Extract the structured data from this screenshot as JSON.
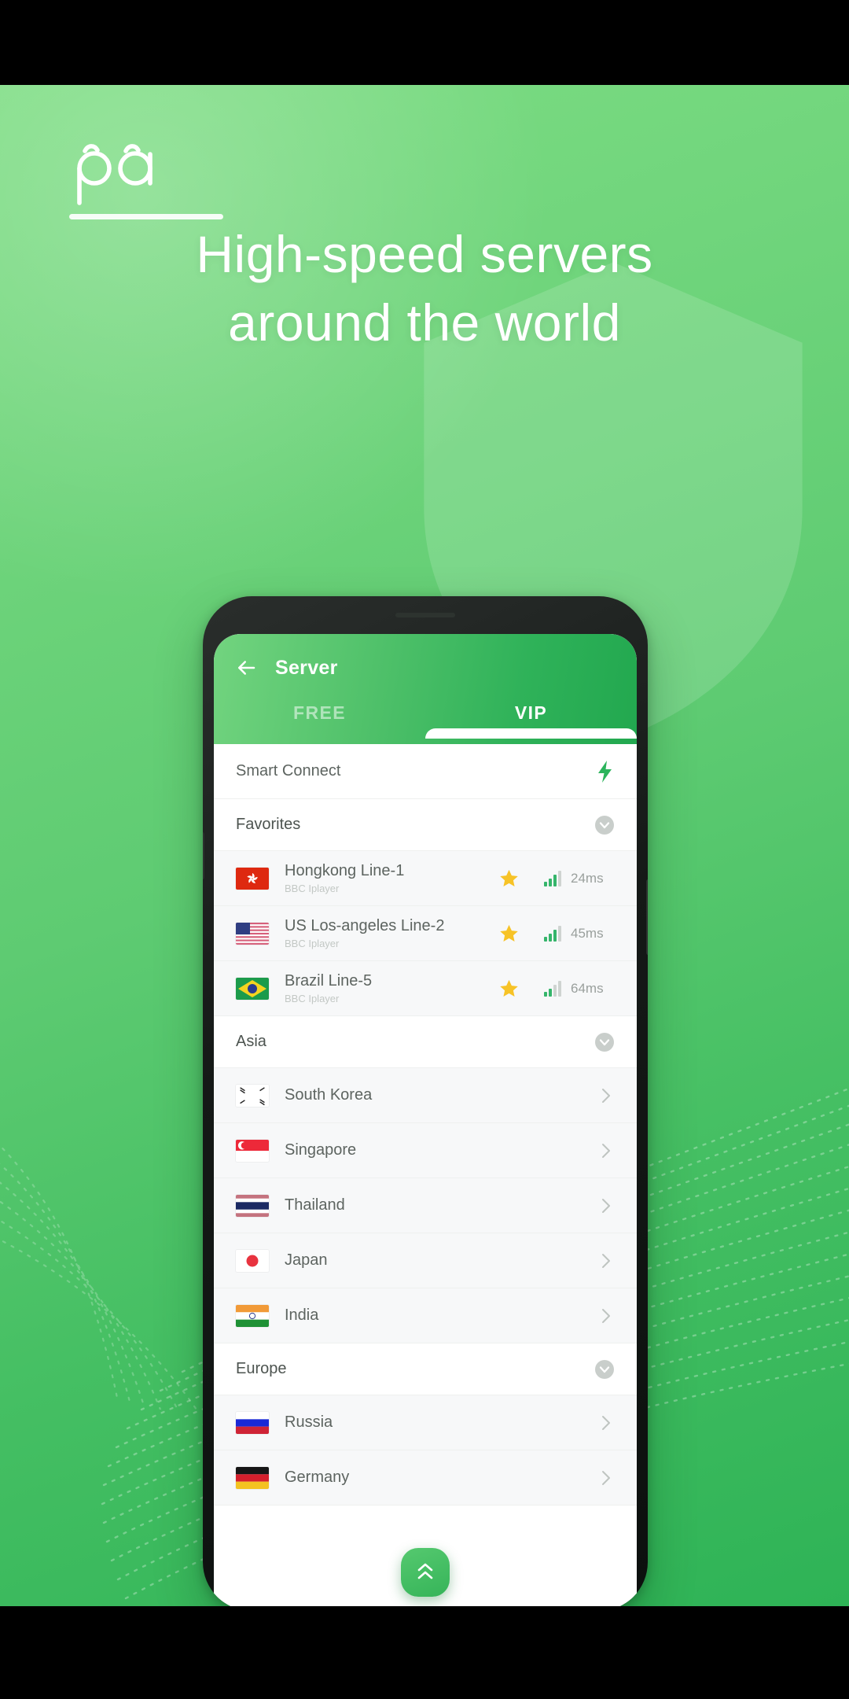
{
  "brand": {
    "wordmark": "pa",
    "logo_icon": "panda-wordmark-logo"
  },
  "headline": {
    "line1": "High-speed servers",
    "line2": "around the world"
  },
  "colors": {
    "accent_green": "#2fb259",
    "header_gradient_start": "#72d47f",
    "header_gradient_end": "#22a84f",
    "poster_bg_start": "#7ddd83",
    "poster_bg_end": "#2eb356",
    "star_gold": "#f7c327",
    "signal_green": "#35b56b",
    "muted_text": "#9aa09d",
    "row_text": "#5d6460",
    "letterbox": "#000000"
  },
  "app": {
    "header": {
      "back_icon": "arrow-left-icon",
      "title": "Server",
      "tabs": [
        {
          "label": "FREE",
          "active": false
        },
        {
          "label": "VIP",
          "active": true
        }
      ]
    },
    "smart_connect": {
      "label": "Smart Connect",
      "icon": "lightning-bolt-icon"
    },
    "sections": [
      {
        "title": "Favorites",
        "collapse_icon": "chevron-down-circle-icon",
        "type": "servers",
        "items": [
          {
            "name": "Hongkong Line-1",
            "subtitle": "BBC Iplayer",
            "flag": "hongkong-flag",
            "favorite_icon": "star-filled-icon",
            "signal_icon": "signal-bars-icon",
            "signal_level": 3,
            "ping": "24ms"
          },
          {
            "name": "US Los-angeles Line-2",
            "subtitle": "BBC Iplayer",
            "flag": "us-flag",
            "favorite_icon": "star-filled-icon",
            "signal_icon": "signal-bars-icon",
            "signal_level": 3,
            "ping": "45ms"
          },
          {
            "name": "Brazil Line-5",
            "subtitle": "BBC Iplayer",
            "flag": "brazil-flag",
            "favorite_icon": "star-filled-icon",
            "signal_icon": "signal-bars-icon",
            "signal_level": 2,
            "ping": "64ms"
          }
        ]
      },
      {
        "title": "Asia",
        "collapse_icon": "chevron-down-circle-icon",
        "type": "countries",
        "items": [
          {
            "name": "South Korea",
            "flag": "south-korea-flag",
            "chevron": "chevron-right-icon"
          },
          {
            "name": "Singapore",
            "flag": "singapore-flag",
            "chevron": "chevron-right-icon"
          },
          {
            "name": "Thailand",
            "flag": "thailand-flag",
            "chevron": "chevron-right-icon"
          },
          {
            "name": "Japan",
            "flag": "japan-flag",
            "chevron": "chevron-right-icon"
          },
          {
            "name": "India",
            "flag": "india-flag",
            "chevron": "chevron-right-icon"
          }
        ]
      },
      {
        "title": "Europe",
        "collapse_icon": "chevron-down-circle-icon",
        "type": "countries",
        "items": [
          {
            "name": "Russia",
            "flag": "russia-flag",
            "chevron": "chevron-right-icon"
          },
          {
            "name": "Germany",
            "flag": "germany-flag",
            "chevron": "chevron-right-icon"
          }
        ]
      }
    ],
    "fab": {
      "icon": "double-chevron-up-icon"
    }
  }
}
